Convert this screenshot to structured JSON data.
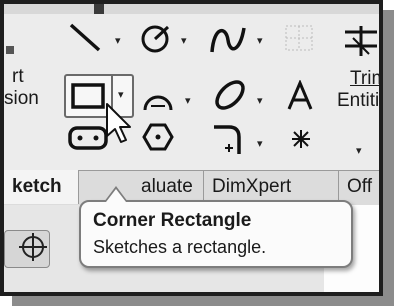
{
  "toolbar": {
    "left_labels": [
      "rt",
      "sion"
    ],
    "trim_label": "Trim",
    "entities_label": "Entiti",
    "caret": "▾",
    "more_caret": "▾"
  },
  "tabs": [
    {
      "label": "ketch",
      "active": true
    },
    {
      "label": "aluate",
      "active": false
    },
    {
      "label": "DimXpert",
      "active": false
    },
    {
      "label": "Off",
      "active": false
    }
  ],
  "tooltip": {
    "title": "Corner Rectangle",
    "description": "Sketches a rectangle."
  },
  "icons": [
    "line-icon",
    "smart-dimension-icon",
    "spline-icon",
    "grid-icon",
    "trim-entities-icon",
    "corner-rectangle-icon",
    "arc-icon",
    "ellipse-icon",
    "text-icon",
    "slot-icon",
    "polygon-icon",
    "fillet-icon",
    "point-icon",
    "target-icon",
    "cursor-icon"
  ]
}
